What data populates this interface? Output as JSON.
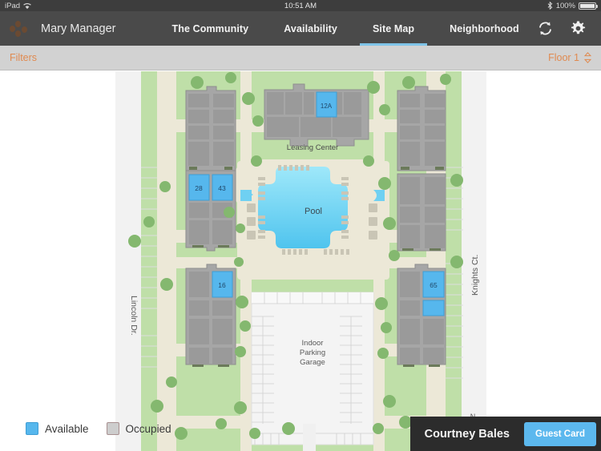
{
  "status_bar": {
    "device": "iPad",
    "wifi_icon": "wifi-icon",
    "time": "10:51 AM",
    "bluetooth_icon": "bluetooth-icon",
    "battery_percent": "100%",
    "battery_icon": "battery-full-icon"
  },
  "navbar": {
    "logo_icon": "app-logo-dots-icon",
    "user_name": "Mary Manager",
    "tabs": [
      {
        "label": "The Community",
        "active": false
      },
      {
        "label": "Availability",
        "active": false
      },
      {
        "label": "Site Map",
        "active": true
      },
      {
        "label": "Neighborhood",
        "active": false
      }
    ],
    "refresh_icon": "refresh-sync-icon",
    "settings_icon": "gear-icon",
    "accent_underline": "#7fc4e8"
  },
  "filter_bar": {
    "filters_label": "Filters",
    "floor_label": "Floor 1",
    "stepper_icon": "stepper-up-down-icon",
    "accent_color": "#e08a50"
  },
  "map": {
    "title": "Site Map",
    "pool_label": "Pool",
    "leasing_center_label": "Leasing Center",
    "parking_label": "Indoor\nParking\nGarage",
    "parking_line1": "Indoor",
    "parking_line2": "Parking",
    "parking_line3": "Garage",
    "street_left": "Lincoln Dr.",
    "street_right": "Knights Ct.",
    "compass_label": "N",
    "compass_icon": "compass-north-icon",
    "available_units": [
      {
        "id": "12A",
        "building": "leasing-center"
      },
      {
        "id": "28",
        "building": "west-north"
      },
      {
        "id": "43",
        "building": "west-north"
      },
      {
        "id": "16",
        "building": "west-south"
      },
      {
        "id": "65",
        "building": "east-south"
      },
      {
        "id": "",
        "building": "east-south"
      }
    ],
    "colors": {
      "available": "#56b7ed",
      "available_border": "#3f9dd4",
      "occupied": "#b6b6b6",
      "grass": "#b9dba0",
      "path": "#ece8d7",
      "pool_light": "#8fe2f7",
      "pool_dark": "#5fc8ef",
      "road": "#f0f0f0",
      "building_roof": "#9b9b9b",
      "tree": "#8cc178"
    }
  },
  "legend": {
    "items": [
      {
        "label": "Available",
        "color": "#56b7ed"
      },
      {
        "label": "Occupied",
        "color": "#cdcdcd"
      }
    ]
  },
  "guest_bar": {
    "guest_name": "Courtney Bales",
    "guest_card_label": "Guest Card",
    "button_color": "#5cb8ee"
  }
}
